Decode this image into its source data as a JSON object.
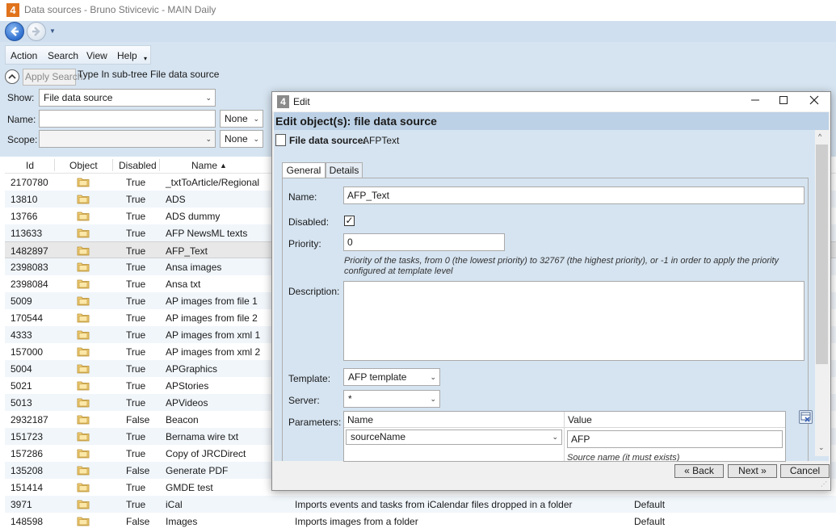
{
  "window": {
    "title": "Data sources - Bruno Stivicevic - MAIN Daily",
    "app_icon": "4"
  },
  "menu": {
    "items": [
      "Action",
      "Search",
      "View",
      "Help"
    ]
  },
  "search": {
    "apply_label": "Apply Search",
    "description": "Type In sub-tree File data source",
    "show_label": "Show:",
    "show_value": "File data source",
    "name_label": "Name:",
    "name_mode": "None",
    "scope_label": "Scope:",
    "scope_mode": "None"
  },
  "grid": {
    "columns": {
      "id": "Id",
      "object": "Object",
      "disabled": "Disabled",
      "name": "Name"
    },
    "rows": [
      {
        "id": "2170780",
        "disabled": "True",
        "name": "_txtToArticle/Regional",
        "description": "",
        "template": ""
      },
      {
        "id": "13810",
        "disabled": "True",
        "name": "ADS",
        "description": "",
        "template": ""
      },
      {
        "id": "13766",
        "disabled": "True",
        "name": "ADS dummy",
        "description": "",
        "template": ""
      },
      {
        "id": "113633",
        "disabled": "True",
        "name": "AFP NewsML texts",
        "description": "",
        "template": ""
      },
      {
        "id": "1482897",
        "disabled": "True",
        "name": "AFP_Text",
        "description": "",
        "template": ""
      },
      {
        "id": "2398083",
        "disabled": "True",
        "name": "Ansa images",
        "description": "",
        "template": ""
      },
      {
        "id": "2398084",
        "disabled": "True",
        "name": "Ansa txt",
        "description": "",
        "template": ""
      },
      {
        "id": "5009",
        "disabled": "True",
        "name": "AP images from file 1",
        "description": "",
        "template": ""
      },
      {
        "id": "170544",
        "disabled": "True",
        "name": "AP images from file 2",
        "description": "",
        "template": ""
      },
      {
        "id": "4333",
        "disabled": "True",
        "name": "AP images from xml 1",
        "description": "",
        "template": ""
      },
      {
        "id": "157000",
        "disabled": "True",
        "name": "AP images from xml 2",
        "description": "",
        "template": ""
      },
      {
        "id": "5004",
        "disabled": "True",
        "name": "APGraphics",
        "description": "",
        "template": ""
      },
      {
        "id": "5021",
        "disabled": "True",
        "name": "APStories",
        "description": "",
        "template": ""
      },
      {
        "id": "5013",
        "disabled": "True",
        "name": "APVideos",
        "description": "",
        "template": ""
      },
      {
        "id": "2932187",
        "disabled": "False",
        "name": "Beacon",
        "description": "",
        "template": ""
      },
      {
        "id": "151723",
        "disabled": "True",
        "name": "Bernama wire txt",
        "description": "",
        "template": ""
      },
      {
        "id": "157286",
        "disabled": "True",
        "name": "Copy of JRCDirect",
        "description": "",
        "template": ""
      },
      {
        "id": "135208",
        "disabled": "False",
        "name": "Generate PDF",
        "description": "",
        "template": ""
      },
      {
        "id": "151414",
        "disabled": "True",
        "name": "GMDE test",
        "description": "",
        "template": ""
      },
      {
        "id": "3971",
        "disabled": "True",
        "name": "iCal",
        "description": "Imports events and tasks from iCalendar files dropped in a folder",
        "template": "Default"
      },
      {
        "id": "148598",
        "disabled": "False",
        "name": "Images",
        "description": "Imports images from a folder",
        "template": "Default"
      }
    ]
  },
  "dialog": {
    "title": "Edit",
    "heading": "Edit object(s): file data source",
    "subject_label": "File data source:",
    "subject_value": "AFPText",
    "tabs": [
      "General",
      "Details"
    ],
    "form": {
      "name_label": "Name:",
      "name_value": "AFP_Text",
      "disabled_label": "Disabled:",
      "disabled_mark": "✓",
      "priority_label": "Priority:",
      "priority_value": "0",
      "priority_hint": "Priority of the tasks, from 0 (the lowest priority) to 32767 (the highest priority), or -1 in order to apply the priority configured at template level",
      "description_label": "Description:",
      "template_label": "Template:",
      "template_value": "AFP template",
      "server_label": "Server:",
      "server_value": "*",
      "parameters_label": "Parameters:",
      "params_col_name": "Name",
      "params_col_value": "Value",
      "param_name": "sourceName",
      "param_value": "AFP",
      "param_hint": "Source name (it must exists)"
    },
    "buttons": {
      "back": "« Back",
      "next": "Next »",
      "cancel": "Cancel"
    }
  }
}
